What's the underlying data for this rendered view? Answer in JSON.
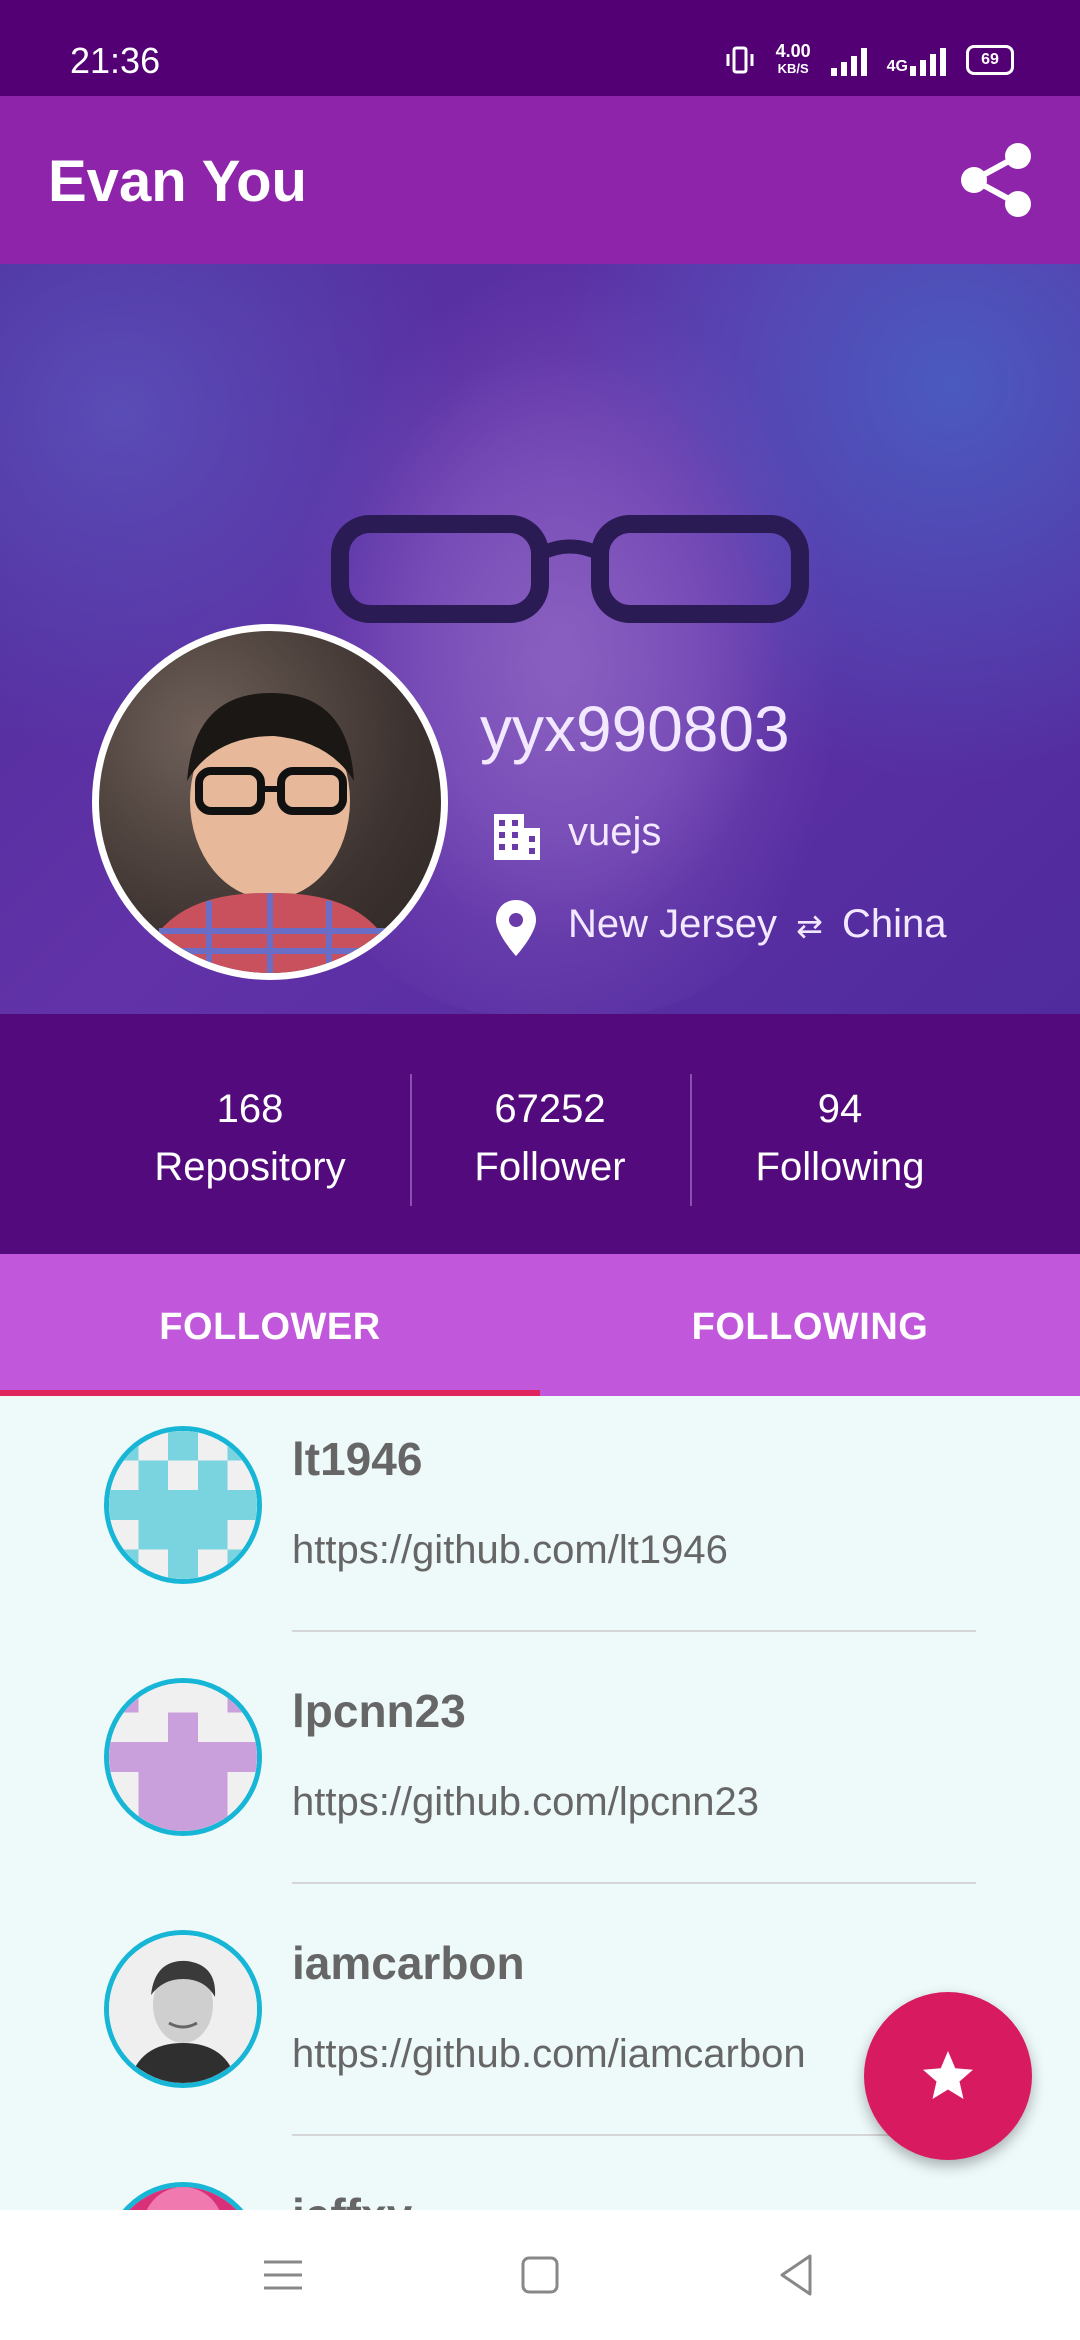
{
  "status": {
    "time": "21:36",
    "net_speed_value": "4.00",
    "net_speed_unit": "KB/S",
    "network_type": "4G",
    "battery": "69"
  },
  "appbar": {
    "title": "Evan You",
    "share_icon": "share-icon"
  },
  "profile": {
    "username": "yyx990803",
    "company": "vuejs",
    "location_from": "New Jersey",
    "location_arrow": "⇄",
    "location_to": "China"
  },
  "stats": [
    {
      "value": "168",
      "label": "Repository"
    },
    {
      "value": "67252",
      "label": "Follower"
    },
    {
      "value": "94",
      "label": "Following"
    }
  ],
  "tabs": {
    "follower": "FOLLOWER",
    "following": "FOLLOWING",
    "active": "follower"
  },
  "followers": [
    {
      "name": "lt1946",
      "url": "https://github.com/lt1946",
      "avatar_color": "#7ad4e0"
    },
    {
      "name": "lpcnn23",
      "url": "https://github.com/lpcnn23",
      "avatar_color": "#c9a0dc"
    },
    {
      "name": "iamcarbon",
      "url": "https://github.com/iamcarbon",
      "avatar_color": "#888888"
    },
    {
      "name": "jeffxy",
      "url": "",
      "avatar_color": "#d9307a"
    }
  ],
  "colors": {
    "statusbar": "#520074",
    "appbar": "#8e24aa",
    "stats_bg": "#520a7c",
    "tabs_bg": "#c158dc",
    "tab_indicator": "#e0245e",
    "fab": "#d81b60",
    "avatar_ring": "#18b6d6"
  },
  "fab_icon": "star-icon"
}
